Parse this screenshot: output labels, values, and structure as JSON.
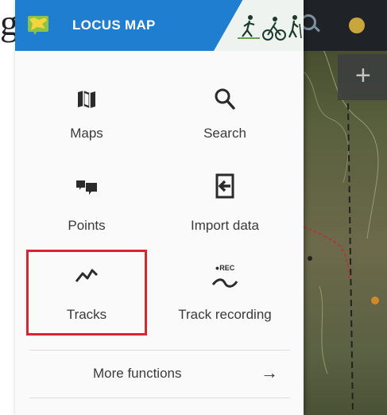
{
  "page_label": "g",
  "header": {
    "title": "LOCUS MAP",
    "bg_color": "#1f7ed0"
  },
  "menu": {
    "items": [
      {
        "label": "Maps",
        "icon": "map-icon"
      },
      {
        "label": "Search",
        "icon": "search-icon"
      },
      {
        "label": "Points",
        "icon": "points-icon"
      },
      {
        "label": "Import data",
        "icon": "import-icon"
      },
      {
        "label": "Tracks",
        "icon": "tracks-icon",
        "highlighted": true
      },
      {
        "label": "Track recording",
        "icon": "track-recording-icon",
        "icon_text": "●REC"
      }
    ],
    "more": {
      "label": "More functions",
      "arrow": "→"
    }
  },
  "map": {
    "zoom_button": "+"
  },
  "colors": {
    "highlight": "#d9262e",
    "text": "#3a3a3a",
    "icon": "#2b2b2b"
  }
}
